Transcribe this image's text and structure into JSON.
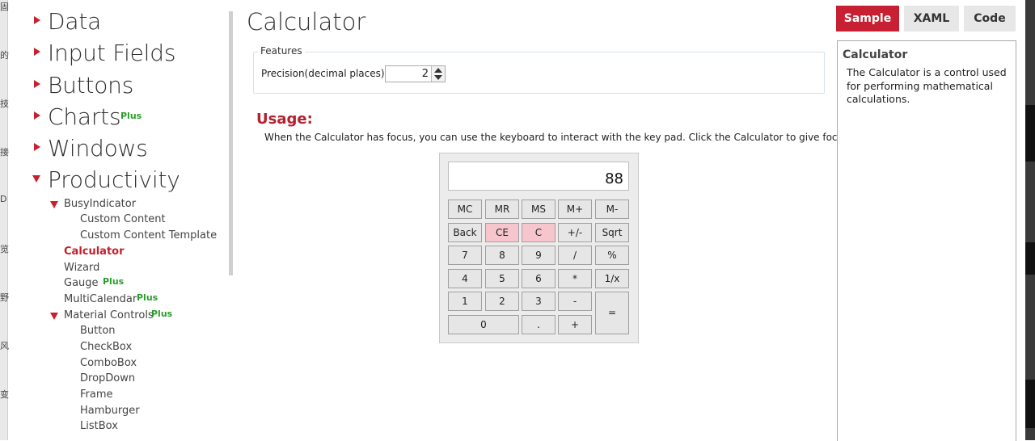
{
  "edge_chars": [
    "固",
    "的",
    "技",
    "接",
    "D",
    "览",
    "野",
    "风",
    "变"
  ],
  "nav": {
    "categories": [
      {
        "label": "Data"
      },
      {
        "label": "Input Fields"
      },
      {
        "label": "Buttons"
      },
      {
        "label": "Charts",
        "badge": "Plus"
      },
      {
        "label": "Windows"
      },
      {
        "label": "Productivity"
      }
    ],
    "sub": {
      "busy": "BusyIndicator",
      "custom_content": "Custom Content",
      "custom_content_template": "Custom Content Template",
      "calculator": "Calculator",
      "wizard": "Wizard",
      "gauge": "Gauge",
      "multicalendar": "MultiCalendar",
      "material": "Material Controls",
      "plus": "Plus",
      "material_items": [
        "Button",
        "CheckBox",
        "ComboBox",
        "DropDown",
        "Frame",
        "Hamburger",
        "ListBox"
      ]
    }
  },
  "main": {
    "title": "Calculator",
    "features_legend": "Features",
    "precision_label": "Precision(decimal places):",
    "precision_value": "2",
    "usage_title": "Usage:",
    "usage_text": "When the Calculator has focus, you can use the keyboard to interact with the key pad. Click the Calculator to give focus."
  },
  "calculator": {
    "display": "88",
    "keys": {
      "mc": "MC",
      "mr": "MR",
      "ms": "MS",
      "mplus": "M+",
      "mminus": "M-",
      "back": "Back",
      "ce": "CE",
      "c": "C",
      "sign": "+/-",
      "sqrt": "Sqrt",
      "k7": "7",
      "k8": "8",
      "k9": "9",
      "div": "/",
      "pct": "%",
      "k4": "4",
      "k5": "5",
      "k6": "6",
      "mul": "*",
      "inv": "1/x",
      "k1": "1",
      "k2": "2",
      "k3": "3",
      "sub": "-",
      "eq": "=",
      "k0": "0",
      "dot": ".",
      "add": "+"
    },
    "highlight_color": "#f7c6cc"
  },
  "tabs": {
    "sample": "Sample",
    "xaml": "XAML",
    "code": "Code",
    "active_color": "#c62032"
  },
  "info": {
    "heading": "Calculator",
    "text": "The Calculator is a control used for performing mathematical calculations."
  }
}
